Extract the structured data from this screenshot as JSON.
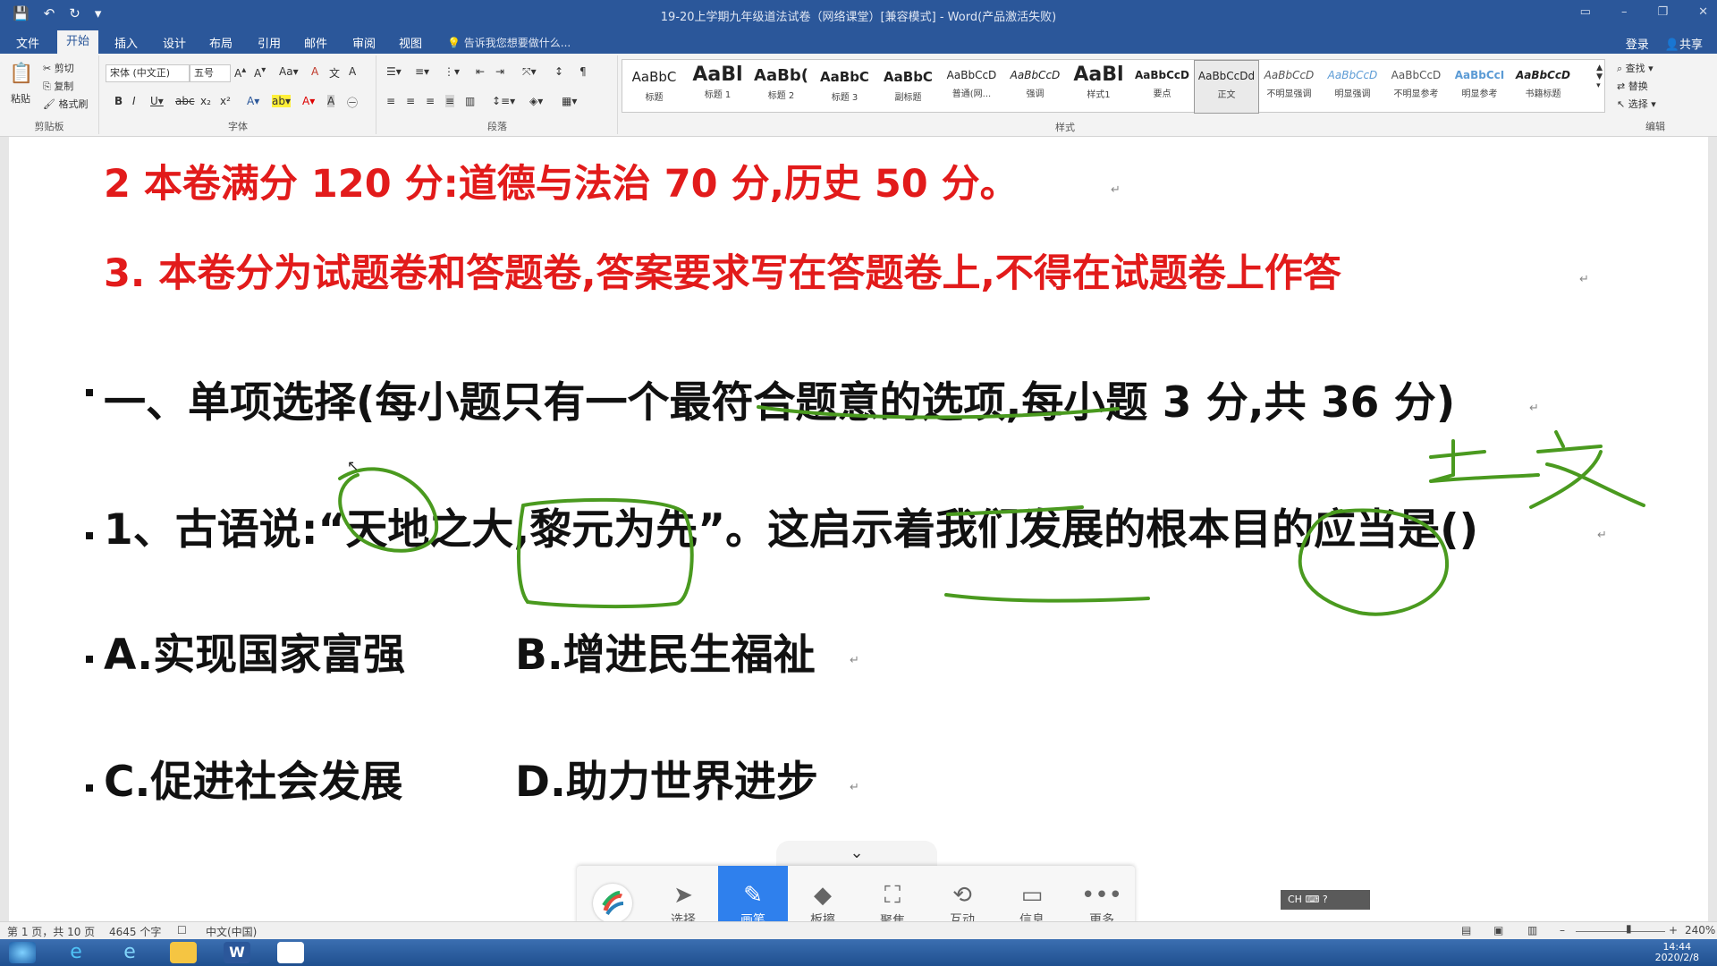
{
  "titlebar": {
    "title": "19-20上学期九年级道法试卷（网络课堂）[兼容模式] - Word(产品激活失败)"
  },
  "tabs": {
    "items": [
      "文件",
      "开始",
      "插入",
      "设计",
      "布局",
      "引用",
      "邮件",
      "审阅",
      "视图"
    ],
    "tellme": "告诉我您想要做什么...",
    "login": "登录",
    "share": "共享"
  },
  "ribbon": {
    "clipboard": {
      "paste": "粘贴",
      "cut": "剪切",
      "copy": "复制",
      "painter": "格式刷",
      "label": "剪贴板"
    },
    "font": {
      "name": "宋体 (中文正)",
      "size": "五号",
      "label": "字体"
    },
    "paragraph": {
      "label": "段落"
    },
    "styles": {
      "label": "样式",
      "items": [
        {
          "sample": "AaBbC",
          "name": "标题"
        },
        {
          "sample": "AaBl",
          "name": "标题 1"
        },
        {
          "sample": "AaBb(",
          "name": "标题 2"
        },
        {
          "sample": "AaBbC",
          "name": "标题 3"
        },
        {
          "sample": "AaBbC",
          "name": "副标题"
        },
        {
          "sample": "AaBbCcD",
          "name": "普通(网..."
        },
        {
          "sample": "AaBbCcD",
          "name": "强调"
        },
        {
          "sample": "AaBl",
          "name": "样式1"
        },
        {
          "sample": "AaBbCcD",
          "name": "要点"
        },
        {
          "sample": "AaBbCcDd",
          "name": "正文"
        },
        {
          "sample": "AaBbCcD",
          "name": "不明显强调"
        },
        {
          "sample": "AaBbCcD",
          "name": "明显强调"
        },
        {
          "sample": "AaBbCcD",
          "name": "不明显参考"
        },
        {
          "sample": "AaBbCcI",
          "name": "明显参考"
        },
        {
          "sample": "AaBbCcD",
          "name": "书籍标题"
        }
      ]
    },
    "editing": {
      "find": "查找",
      "replace": "替换",
      "select": "选择",
      "label": "编辑"
    }
  },
  "document": {
    "line1": "2 本卷满分 120 分:道德与法治 70 分,历史 50 分。",
    "line2": "3. 本卷分为试题卷和答题卷,答案要求写在答题卷上,不得在试题卷上作答",
    "section1": "一、单项选择(每小题只有一个最符合题意的选项,每小题 3 分,共 36 分)",
    "q1": "1、古语说:“天地之大,黎元为先”。这启示着我们发展的根本目的应当是()",
    "optA": "A.实现国家富强",
    "optB": "B.增进民生福祉",
    "optC": "C.促进社会发展",
    "optD": "D.助力世界进步",
    "ink_color": "#4a9a1f"
  },
  "floatbar": {
    "items": [
      {
        "icon": "cursor-icon",
        "label": "选择"
      },
      {
        "icon": "pen-icon",
        "label": "画笔"
      },
      {
        "icon": "eraser-icon",
        "label": "板擦"
      },
      {
        "icon": "focus-icon",
        "label": "聚焦"
      },
      {
        "icon": "interact-icon",
        "label": "互动"
      },
      {
        "icon": "monitor-icon",
        "label": "信息"
      },
      {
        "icon": "more-icon",
        "label": "更多"
      }
    ]
  },
  "ime": {
    "text": "CH"
  },
  "statusbar": {
    "page": "第 1 页，共 10 页",
    "words": "4645 个字",
    "language": "中文(中国)",
    "zoom": "240%"
  },
  "taskbar": {
    "time": "14:44",
    "date": "2020/2/8"
  }
}
